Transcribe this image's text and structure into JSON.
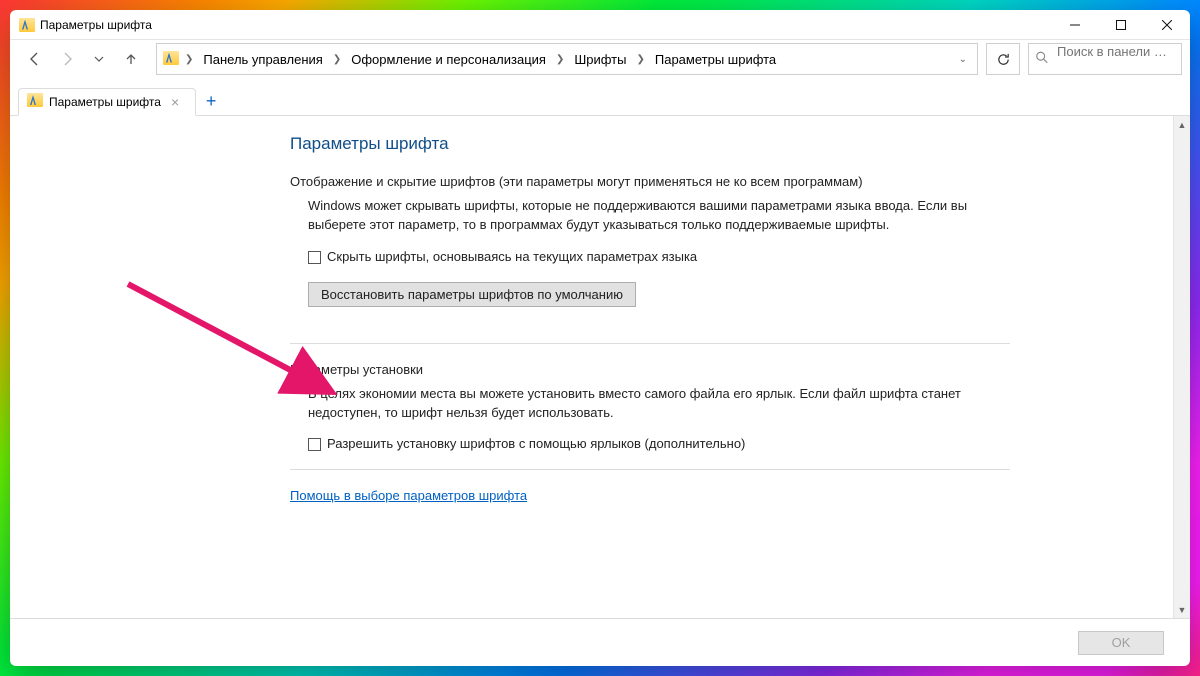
{
  "window": {
    "title": "Параметры шрифта"
  },
  "breadcrumbs": {
    "0": "Панель управления",
    "1": "Оформление и персонализация",
    "2": "Шрифты",
    "3": "Параметры шрифта"
  },
  "search": {
    "placeholder": "Поиск в панели …"
  },
  "tab": {
    "label": "Параметры шрифта"
  },
  "page": {
    "title": "Параметры шрифта",
    "section1_head": "Отображение и скрытие шрифтов (эти параметры могут применяться не ко всем программам)",
    "section1_body": "Windows может скрывать шрифты, которые не поддерживаются вашими параметрами языка ввода. Если вы выберете этот параметр, то в программах будут указываться только поддерживаемые шрифты.",
    "checkbox1": "Скрыть шрифты, основываясь на текущих параметрах языка",
    "restore_btn": "Восстановить параметры шрифтов по умолчанию",
    "section2_head": "Параметры установки",
    "section2_body": "В целях экономии места вы можете установить вместо самого файла его ярлык. Если файл шрифта станет недоступен, то шрифт нельзя будет использовать.",
    "checkbox2": "Разрешить установку шрифтов с помощью ярлыков (дополнительно)",
    "help_link": "Помощь в выборе параметров шрифта"
  },
  "footer": {
    "ok": "OK"
  }
}
